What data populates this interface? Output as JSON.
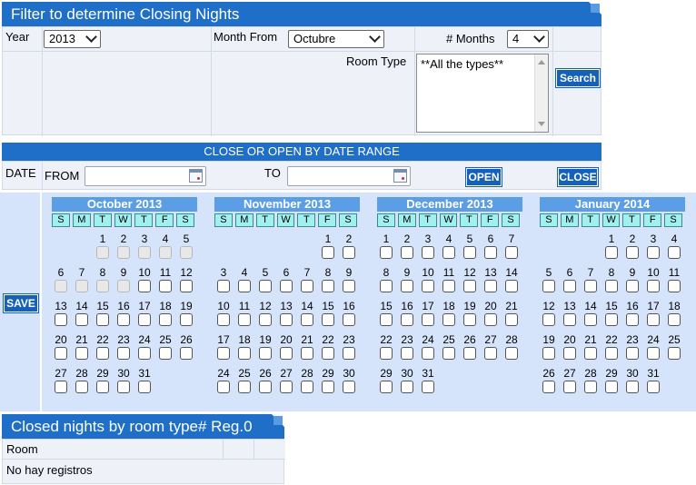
{
  "filter": {
    "title": "Filter to determine Closing Nights",
    "year_label": "Year",
    "year_value": "2013",
    "month_from_label": "Month From",
    "month_from_value": "Octubre",
    "months_label": "# Months",
    "months_value": "4",
    "room_type_label": "Room Type",
    "room_type_value": "**All the types**",
    "search_label": "Search"
  },
  "range": {
    "title": "CLOSE OR OPEN BY DATE RANGE",
    "date_label": "DATE",
    "from_label": "FROM",
    "to_label": "TO",
    "from_value": "",
    "to_value": "",
    "open_label": "OPEN",
    "close_label": "CLOSE"
  },
  "calendar": {
    "save_label": "SAVE",
    "weekdays": [
      "S",
      "M",
      "T",
      "W",
      "T",
      "F",
      "S"
    ],
    "months": [
      {
        "title": "October 2013",
        "start": 2,
        "days": 31,
        "disabled_until": 9
      },
      {
        "title": "November 2013",
        "start": 5,
        "days": 30,
        "disabled_until": 0
      },
      {
        "title": "December 2013",
        "start": 0,
        "days": 31,
        "disabled_until": 0
      },
      {
        "title": "January 2014",
        "start": 3,
        "days": 31,
        "disabled_until": 0
      }
    ]
  },
  "closed": {
    "title": "Closed nights by room type# Reg.0",
    "column_room": "Room",
    "empty_text": "No hay registros"
  }
}
